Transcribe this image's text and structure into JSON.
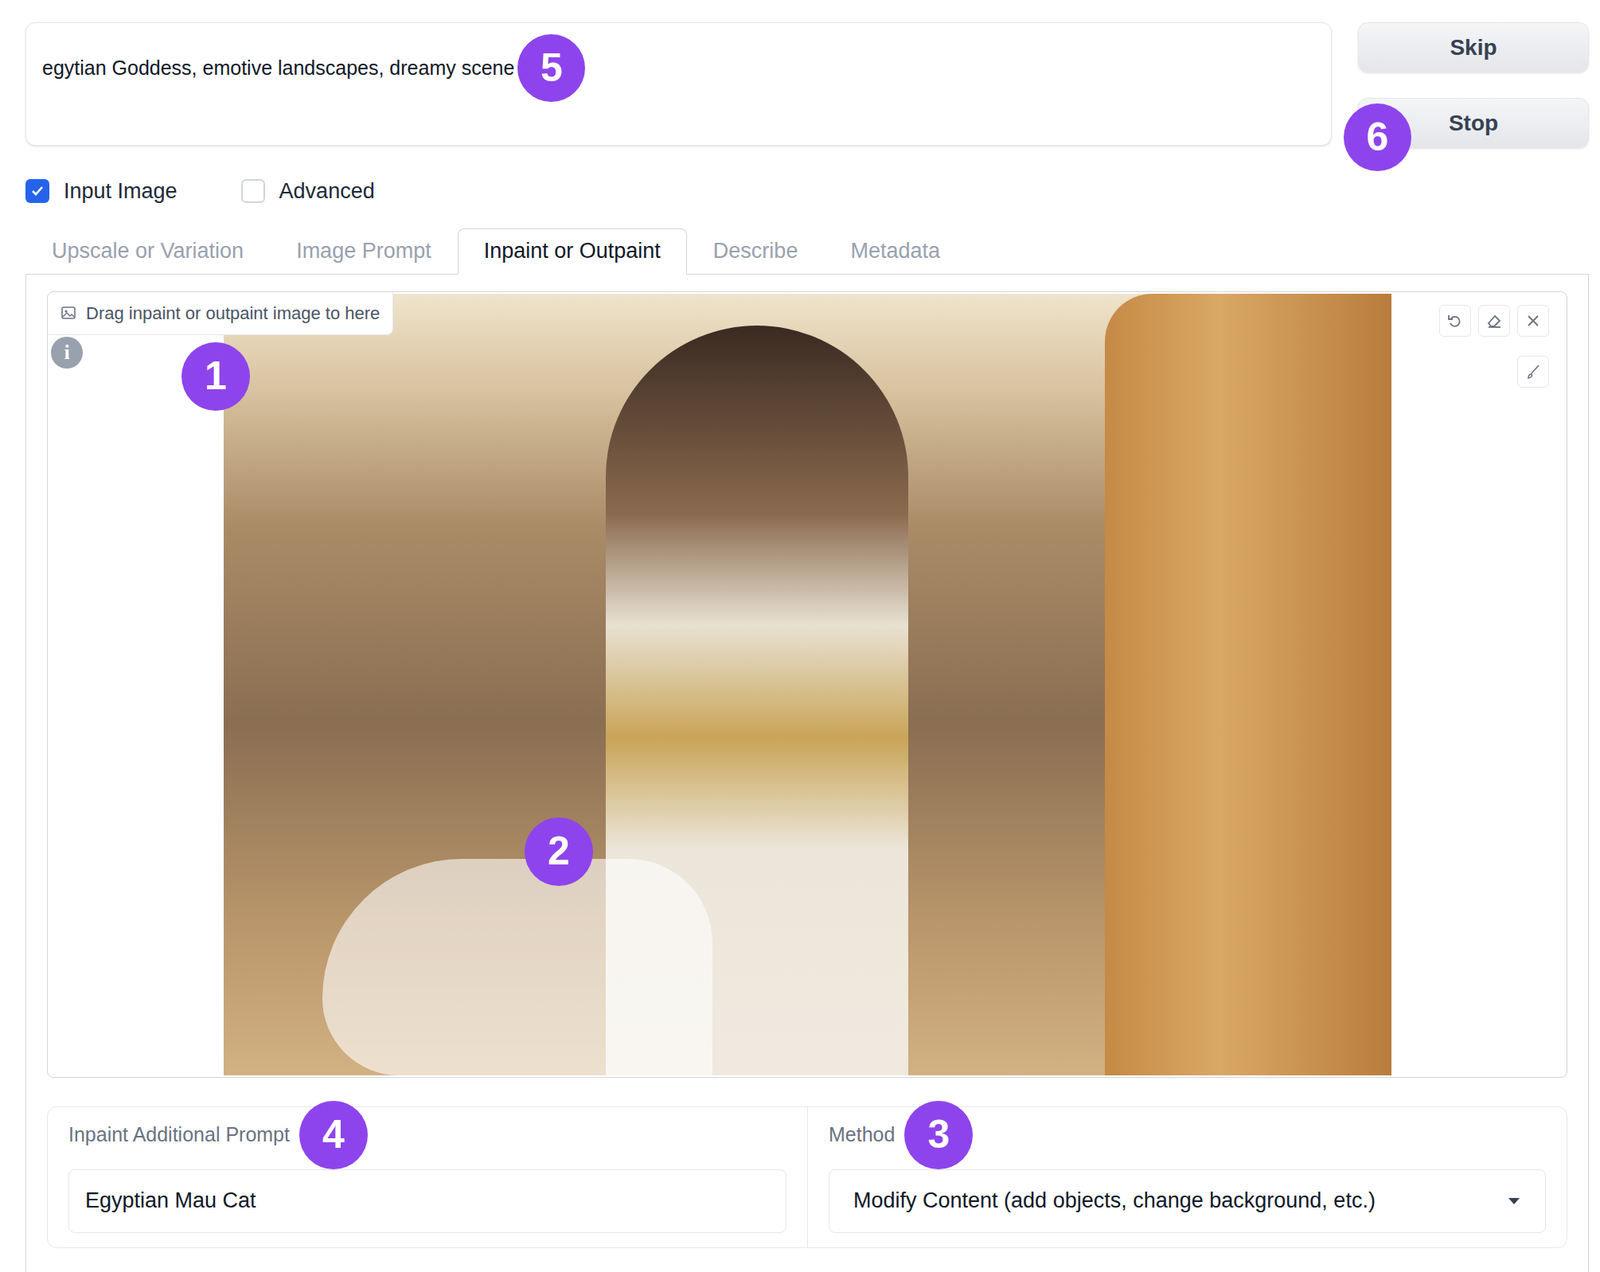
{
  "prompt": {
    "value": "egytian Goddess, emotive landscapes, dreamy scene",
    "badge": "5"
  },
  "buttons": [
    {
      "label": "Skip",
      "badge": ""
    },
    {
      "label": "Stop",
      "badge": "6"
    }
  ],
  "options": [
    {
      "label": "Input Image",
      "checked": true
    },
    {
      "label": "Advanced",
      "checked": false
    }
  ],
  "tabs": [
    {
      "label": "Upscale or Variation",
      "selected": false
    },
    {
      "label": "Image Prompt",
      "selected": false
    },
    {
      "label": "Inpaint or Outpaint",
      "selected": true
    },
    {
      "label": "Describe",
      "selected": false
    },
    {
      "label": "Metadata",
      "selected": false
    }
  ],
  "canvas": {
    "hint": "Drag inpaint or outpaint image to here",
    "info": "i",
    "badge": "1",
    "mask_badge": "2"
  },
  "inpaint_prompt": {
    "label": "Inpaint Additional Prompt",
    "value": "Egyptian Mau Cat",
    "badge": "4"
  },
  "method": {
    "label": "Method",
    "value": "Modify Content (add objects, change background, etc.)",
    "badge": "3"
  }
}
